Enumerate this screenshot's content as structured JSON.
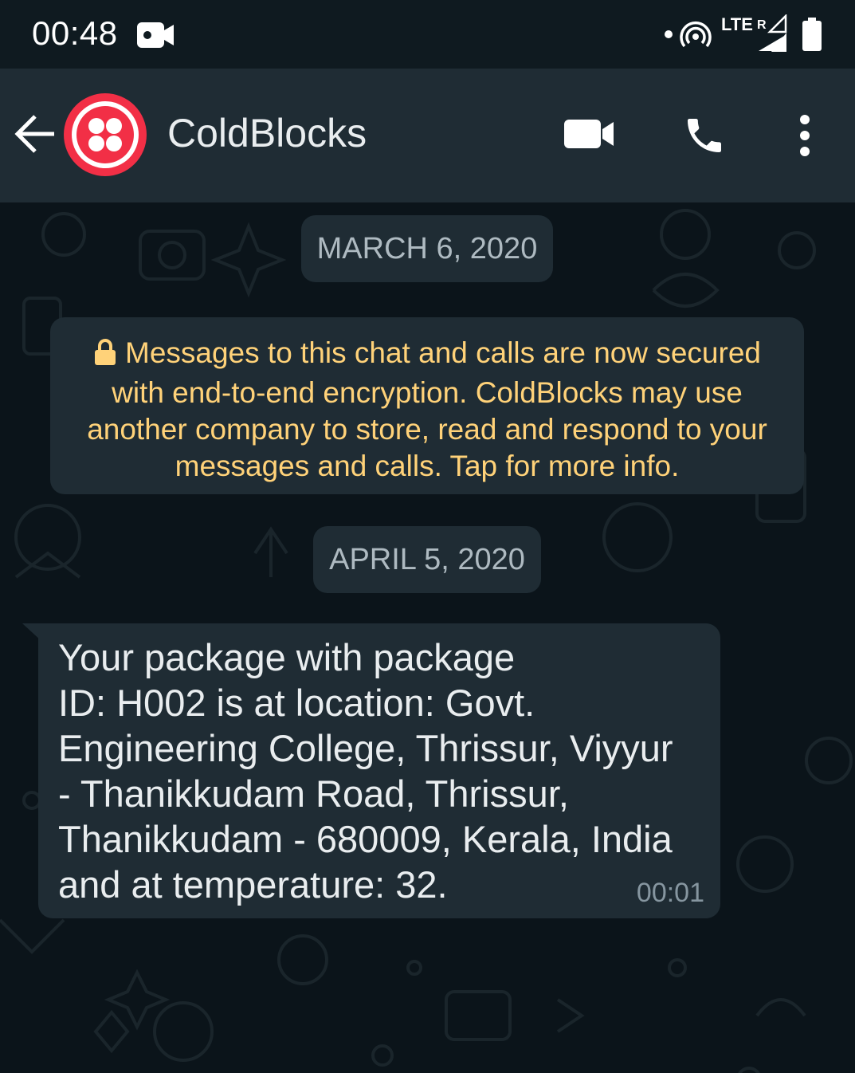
{
  "status_bar": {
    "time": "00:48",
    "network": "LTE",
    "roaming": "R",
    "icons": [
      "video-camera-icon",
      "hotspot-icon",
      "signal-icon",
      "battery-icon"
    ]
  },
  "header": {
    "contact_name": "ColdBlocks",
    "icons": [
      "back-arrow-icon",
      "video-call-icon",
      "voice-call-icon",
      "more-options-icon"
    ],
    "avatar_color": "#f22f46",
    "background": "#1f2c34"
  },
  "chat": {
    "date_1": "MARCH 6, 2020",
    "encryption_notice": "Messages to this chat and calls are now secured with end-to-end encryption. ColdBlocks may use another company to store, read and respond to your messages and calls. Tap for more info.",
    "date_2": "APRIL 5, 2020",
    "messages": [
      {
        "text": "Your package with package\nID: H002 is at location: Govt.\nEngineering College, Thrissur, Viyyur\n- Thanikkudam Road, Thrissur,\nThanikkudam - 680009, Kerala, India\nand at temperature: 32.",
        "time": "00:01"
      }
    ],
    "notice_color": "#ffd279",
    "bubble_color": "#1f2c34"
  }
}
